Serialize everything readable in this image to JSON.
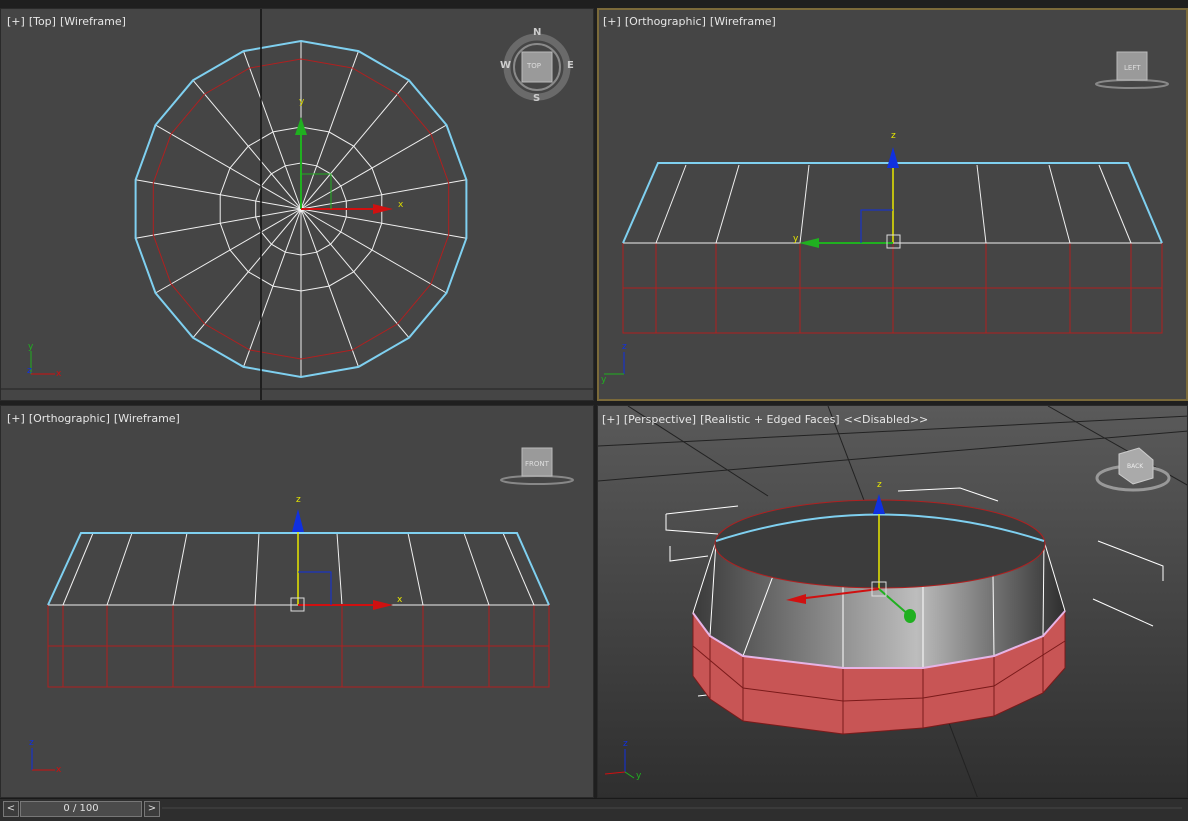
{
  "viewports": {
    "top_left": {
      "plus": "[+]",
      "view": "[Top]",
      "mode": "[Wireframe]",
      "cube_face": "TOP",
      "compass": {
        "n": "N",
        "s": "S",
        "e": "E",
        "w": "W"
      }
    },
    "top_right": {
      "plus": "[+]",
      "view": "[Orthographic]",
      "mode": "[Wireframe]",
      "cube_face": "LEFT"
    },
    "bottom_left": {
      "plus": "[+]",
      "view": "[Orthographic]",
      "mode": "[Wireframe]",
      "cube_face": "FRONT"
    },
    "bottom_right": {
      "plus": "[+]",
      "view": "[Perspective]",
      "mode": "[Realistic + Edged Faces]",
      "extra": "<<Disabled>>",
      "cube_face": "BACK"
    }
  },
  "axes": {
    "x": "x",
    "y": "y",
    "z": "z"
  },
  "timeline": {
    "prev": "<",
    "next": ">",
    "frame_label": "0 / 100"
  },
  "colors": {
    "viewport_bg": "#454545",
    "active_border": "#7b6a3a",
    "selection_cyan": "#7fd0f0",
    "wire_red": "#b02020",
    "axis_x": "#e01010",
    "axis_y": "#10b010",
    "axis_z": "#1030e0"
  }
}
